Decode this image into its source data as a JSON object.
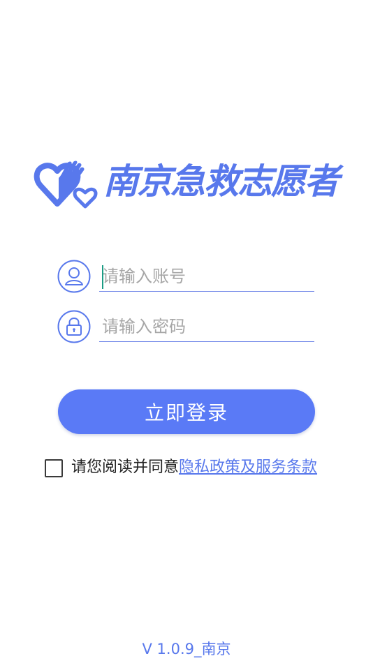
{
  "app": {
    "title": "南京急救志愿者"
  },
  "login_form": {
    "account": {
      "placeholder": "请输入账号",
      "value": ""
    },
    "password": {
      "placeholder": "请输入密码",
      "value": ""
    },
    "submit_label": "立即登录"
  },
  "agreement": {
    "prefix": "请您阅读并同意",
    "link_text": "隐私政策及服务条款",
    "checked": false
  },
  "footer": {
    "version": "V 1.0.9_南京"
  },
  "icons": {
    "logo": "heart-hand-logo-icon",
    "account": "user-icon",
    "password": "lock-icon"
  },
  "colors": {
    "accent": "#5a7af6",
    "brand_text": "#5878ec",
    "placeholder": "#a6a6a6",
    "caret": "#1b9c84"
  }
}
